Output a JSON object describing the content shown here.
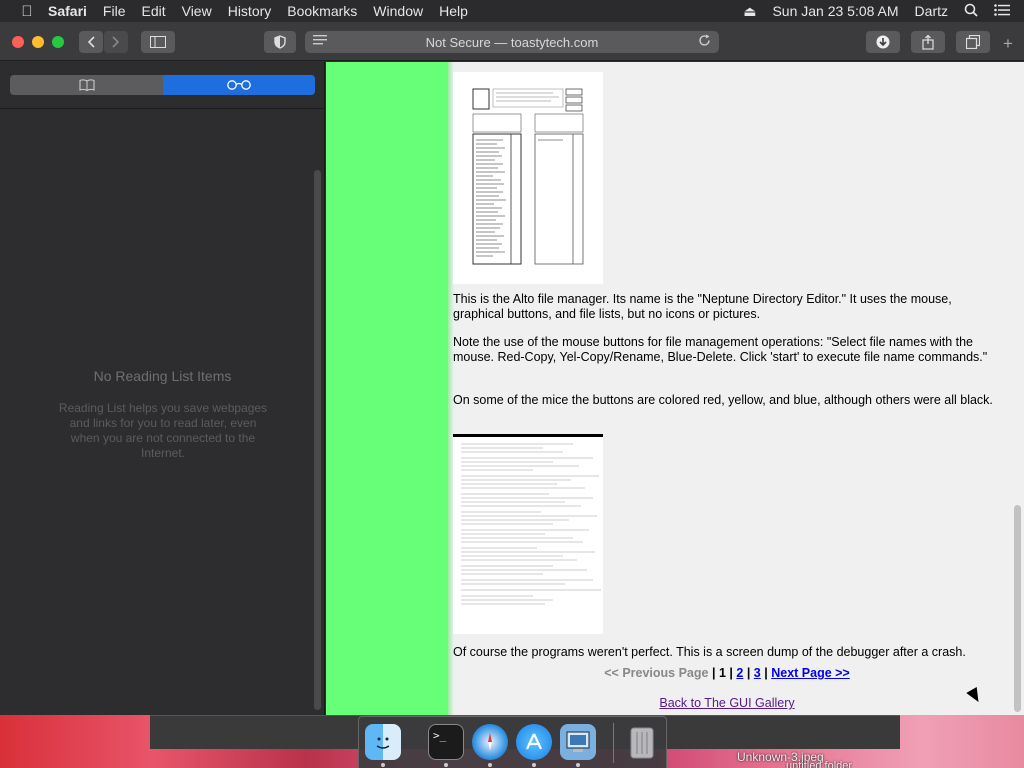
{
  "menubar": {
    "app_name": "Safari",
    "items": [
      "File",
      "Edit",
      "View",
      "History",
      "Bookmarks",
      "Window",
      "Help"
    ],
    "datetime": "Sun Jan 23  5:08 AM",
    "user": "Dartz"
  },
  "toolbar": {
    "address": "Not Secure — toastytech.com"
  },
  "sidebar": {
    "empty_title": "No Reading List Items",
    "empty_body": "Reading List helps you save webpages and links for you to read later, even when you are not connected to the Internet."
  },
  "page": {
    "para1": "This is the Alto file manager. Its name is the \"Neptune Directory Editor.\" It uses the mouse, graphical buttons, and file lists, but no icons or pictures.",
    "para2": "Note the use of the mouse buttons for file management operations: \"Select file names with the mouse. Red-Copy, Yel-Copy/Rename, Blue-Delete. Click 'start' to execute file name commands.\"",
    "para3": "On some of the mice the buttons are colored red, yellow, and blue, although others were all black.",
    "para4": "Of course the programs weren't perfect. This is a screen dump of the debugger after a crash.",
    "pager": {
      "prev": "<< Previous Page",
      "sep": "|",
      "current": "1",
      "page2": "2",
      "page3": "3",
      "next": "Next Page >>"
    },
    "back_link": "Back to The GUI Gallery"
  },
  "desktop": {
    "file1": "Unknown-3.jpeg",
    "file2": "untitled folder"
  },
  "dock": {
    "apps": [
      "finder-icon",
      "terminal-icon",
      "safari-icon",
      "app-store-icon",
      "system-icon",
      "trash-icon"
    ]
  }
}
